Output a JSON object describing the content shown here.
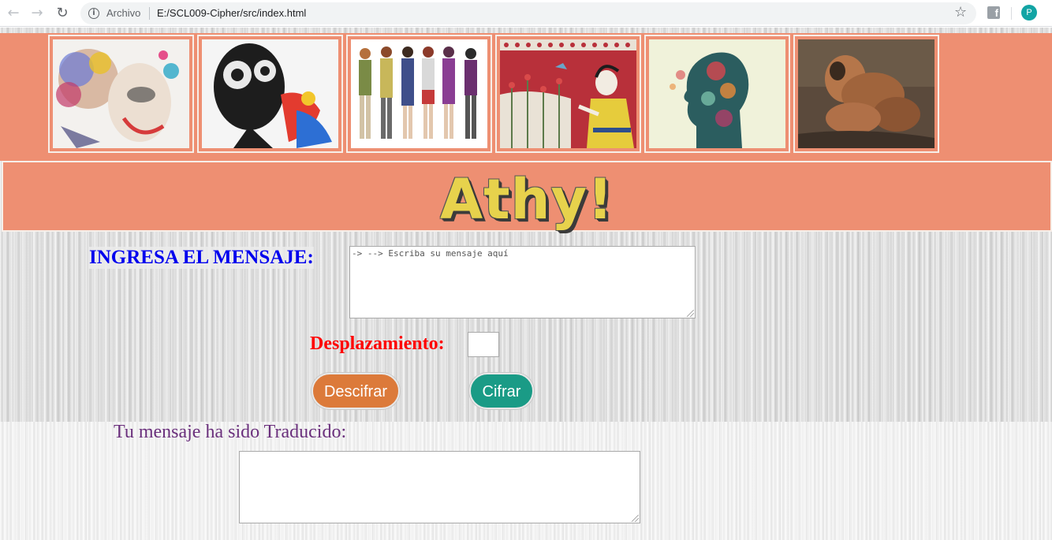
{
  "browser": {
    "scheme_label": "Archivo",
    "url": "E:/SCL009-Cipher/src/index.html",
    "profile_initial": "P",
    "extension_letter": "f"
  },
  "header": {
    "title": "Athy!",
    "gallery": [
      {
        "name": "art-portrait-colorful"
      },
      {
        "name": "art-skull-face"
      },
      {
        "name": "fashion-illustration"
      },
      {
        "name": "minoan-fresco"
      },
      {
        "name": "floral-head-silhouette"
      },
      {
        "name": "figure-painting"
      }
    ]
  },
  "form": {
    "message_label": "INGRESA EL MENSAJE:",
    "message_value": "-> --> Escriba su mensaje aquí",
    "offset_label": "Desplazamiento:",
    "offset_value": "",
    "decipher_label": "Descifrar",
    "cipher_label": "Cifrar"
  },
  "result": {
    "label": "Tu mensaje ha sido Traducido:",
    "value": ""
  },
  "colors": {
    "header_bg": "#ee8f72",
    "title_yellow": "#e7d24c",
    "label_blue": "#0000ee",
    "label_red": "#ff0000",
    "result_purple": "#6a2f7c",
    "decipher_orange": "#dc7a3a",
    "cipher_teal": "#1a9b86"
  }
}
